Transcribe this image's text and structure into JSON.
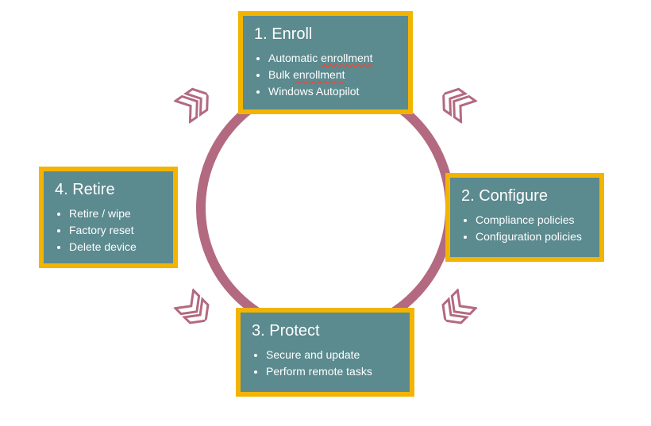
{
  "cycle": {
    "enroll": {
      "title": "1. Enroll",
      "items": [
        {
          "prefix": "Automatic ",
          "squiggle": "enrollment",
          "suffix": ""
        },
        {
          "prefix": "Bulk ",
          "squiggle": "enrollment",
          "suffix": ""
        },
        {
          "prefix": "Windows Autopilot",
          "squiggle": "",
          "suffix": ""
        }
      ]
    },
    "configure": {
      "title": "2. Configure",
      "items": [
        {
          "prefix": "Compliance policies",
          "squiggle": "",
          "suffix": ""
        },
        {
          "prefix": "Configuration policies",
          "squiggle": "",
          "suffix": ""
        }
      ]
    },
    "protect": {
      "title": "3. Protect",
      "items": [
        {
          "prefix": "Secure and update",
          "squiggle": "",
          "suffix": ""
        },
        {
          "prefix": "Perform remote tasks",
          "squiggle": "",
          "suffix": ""
        }
      ]
    },
    "retire": {
      "title": "4. Retire",
      "items": [
        {
          "prefix": "Retire / wipe",
          "squiggle": "",
          "suffix": ""
        },
        {
          "prefix": "Factory reset",
          "squiggle": "",
          "suffix": ""
        },
        {
          "prefix": "Delete device",
          "squiggle": "",
          "suffix": ""
        }
      ]
    }
  },
  "colors": {
    "box_fill": "#5b8a8f",
    "box_border": "#f2b400",
    "ring": "#b36a81",
    "arrow_fill": "#ffffff",
    "arrow_edge": "#b36a81",
    "text": "#ffffff",
    "squiggle": "#e74c3c"
  }
}
